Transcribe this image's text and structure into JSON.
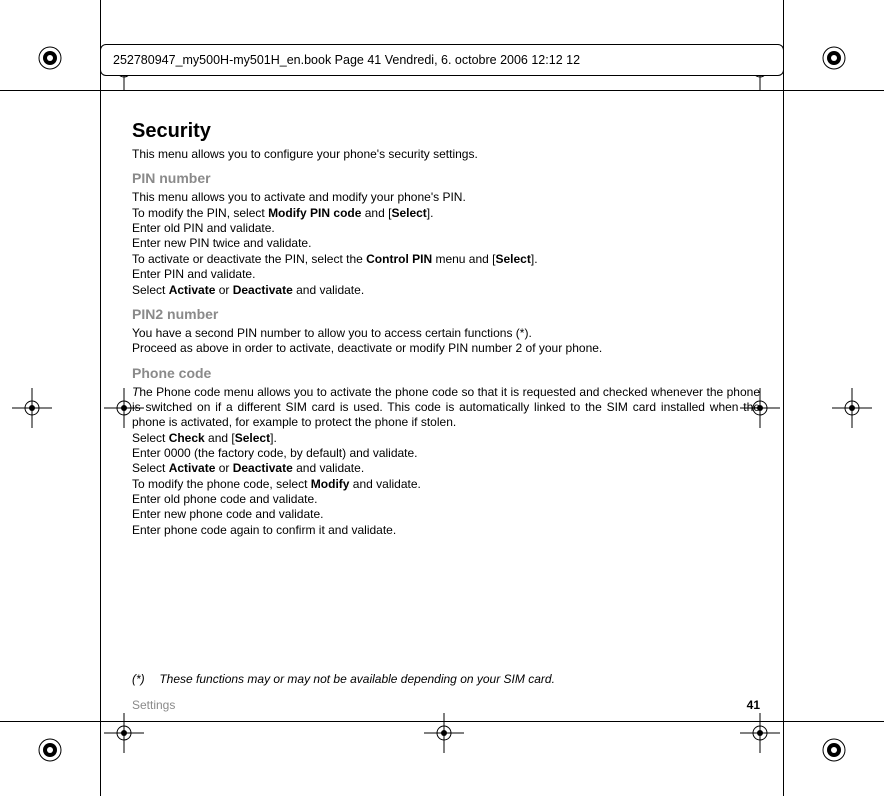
{
  "header": {
    "slug": "252780947_my500H-my501H_en.book  Page 41  Vendredi, 6. octobre 2006  12:12 12"
  },
  "content": {
    "h1": "Security",
    "intro": "This menu allows you to configure your phone's security settings.",
    "pin_h": "PIN number",
    "pin_l1": "This menu allows you to activate and modify your phone's PIN.",
    "pin_l2a": "To modify the PIN, select ",
    "pin_l2b": "Modify PIN code",
    "pin_l2c": " and [",
    "pin_l2d": "Select",
    "pin_l2e": "].",
    "pin_l3": "Enter old PIN and validate.",
    "pin_l4": "Enter new PIN twice and validate.",
    "pin_l5a": "To activate or deactivate the PIN, select the ",
    "pin_l5b": "Control PIN",
    "pin_l5c": " menu and [",
    "pin_l5d": "Select",
    "pin_l5e": "].",
    "pin_l6": "Enter PIN and validate.",
    "pin_l7a": "Select ",
    "pin_l7b": "Activate",
    "pin_l7c": " or ",
    "pin_l7d": "Deactivate",
    "pin_l7e": " and validate.",
    "pin2_h": "PIN2 number",
    "pin2_l1": "You have a second PIN number to allow you to access certain functions (*).",
    "pin2_l2": "Proceed as above in order to activate, deactivate or modify PIN number 2 of your phone.",
    "pc_h": "Phone code",
    "pc_p1a": "T",
    "pc_p1b": "he Phone code menu allows you to activate the phone code so that it is requested and checked whenever the phone is switched on if a different SIM card is used. This code is automatically linked to the SIM card installed when the phone is activated, for example to protect the phone if stolen.",
    "pc_l2a": "Select ",
    "pc_l2b": "Check",
    "pc_l2c": " and [",
    "pc_l2d": "Select",
    "pc_l2e": "].",
    "pc_l3": "Enter 0000 (the factory code, by default) and validate.",
    "pc_l4a": "Select ",
    "pc_l4b": "Activate",
    "pc_l4c": " or ",
    "pc_l4d": "Deactivate",
    "pc_l4e": " and validate.",
    "pc_l5a": "To modify the phone code, select ",
    "pc_l5b": "Modify",
    "pc_l5c": " and validate.",
    "pc_l6": "Enter old phone code and validate.",
    "pc_l7": "Enter new phone code and validate.",
    "pc_l8": "Enter phone code again to confirm it and validate."
  },
  "footnote": {
    "mark": "(*)",
    "text": "These functions may or may not be available depending on your SIM card."
  },
  "footer": {
    "section": "Settings",
    "page": "41"
  }
}
